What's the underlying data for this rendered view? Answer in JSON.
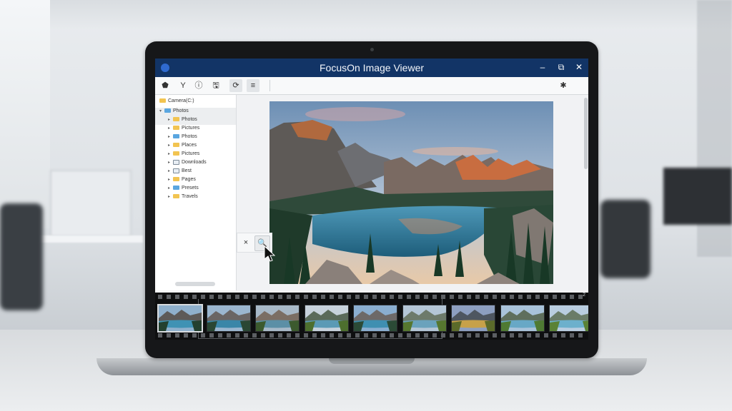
{
  "window": {
    "title": "FocusOn Image Viewer",
    "minimize": "–",
    "maximize": "⧉",
    "close": "✕"
  },
  "toolbar": {
    "buttons": [
      {
        "name": "home-icon",
        "glyph": "⬟"
      },
      {
        "name": "filter-icon",
        "glyph": "Y"
      },
      {
        "name": "info-icon",
        "glyph": "ⓘ"
      },
      {
        "name": "save-icon",
        "glyph": "🖫"
      },
      {
        "name": "refresh-icon",
        "glyph": "⟳"
      },
      {
        "name": "menu-icon",
        "glyph": "≡"
      }
    ],
    "right_icon": "✱"
  },
  "sidebar": {
    "root": "Camera(C:)",
    "selected": "Photos",
    "items": [
      "Photos",
      "Pictures",
      "Photos",
      "Places",
      "Pictures",
      "Downloads",
      "Best",
      "Pages",
      "Presets",
      "Travels"
    ]
  },
  "viewer": {
    "zoom_close": "×",
    "zoom_icon": "🔍",
    "page_number": "2"
  },
  "filmstrip": {
    "count": 9,
    "selected_index": 0
  }
}
